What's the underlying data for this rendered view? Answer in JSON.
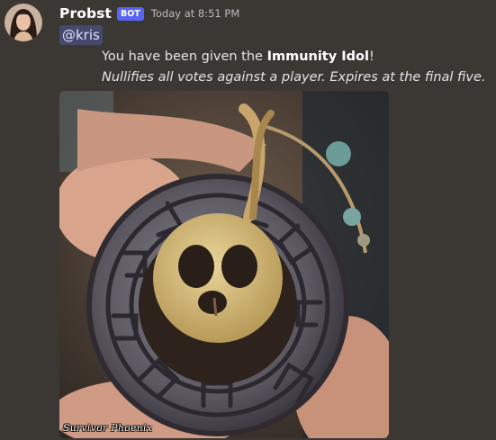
{
  "message": {
    "author": "Probst",
    "bot_badge": "BOT",
    "timestamp": "Today at 8:51 PM",
    "mention": "@kris",
    "text_prefix": "You have been given the ",
    "text_bold": "Immunity Idol",
    "text_suffix": "!",
    "italic_line": "Nullifies all votes against a player. Expires at the final five."
  },
  "attachment": {
    "watermark": "Survivor Phoenix"
  },
  "colors": {
    "background": "#3b3833",
    "bot_badge": "#5865f2",
    "mention_bg": "#45496b"
  }
}
